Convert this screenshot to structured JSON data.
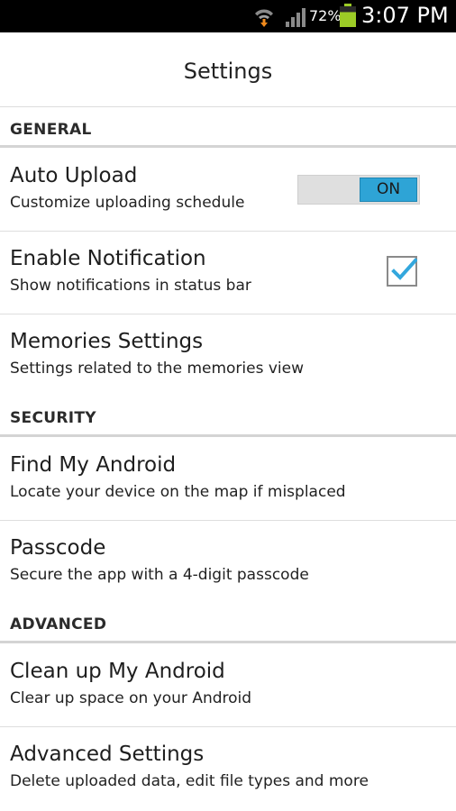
{
  "status_bar": {
    "battery_percent": "72%",
    "time": "3:07 PM",
    "icons": [
      "wifi-icon",
      "signal-icon",
      "battery-icon"
    ],
    "battery_level": 0.72
  },
  "header": {
    "title": "Settings"
  },
  "sections": {
    "general": "GENERAL",
    "security": "SECURITY",
    "advanced": "ADVANCED"
  },
  "items": {
    "auto_upload": {
      "title": "Auto Upload",
      "summary": "Customize uploading schedule",
      "toggle_label": "ON",
      "toggle_state": true
    },
    "enable_notification": {
      "title": "Enable Notification",
      "summary": "Show notifications in status bar",
      "checked": true
    },
    "memories_settings": {
      "title": "Memories Settings",
      "summary": "Settings related to the memories view"
    },
    "find_my_android": {
      "title": "Find My Android",
      "summary": "Locate your device on the map if misplaced"
    },
    "passcode": {
      "title": "Passcode",
      "summary": "Secure the app with a 4-digit passcode"
    },
    "clean_up": {
      "title": "Clean up My Android",
      "summary": "Clear up space on your Android"
    },
    "advanced_settings": {
      "title": "Advanced Settings",
      "summary": "Delete uploaded data, edit file types and more"
    }
  },
  "colors": {
    "accent": "#2ea4d6",
    "battery": "#9ccc26",
    "checkmark": "#33a7dd"
  }
}
